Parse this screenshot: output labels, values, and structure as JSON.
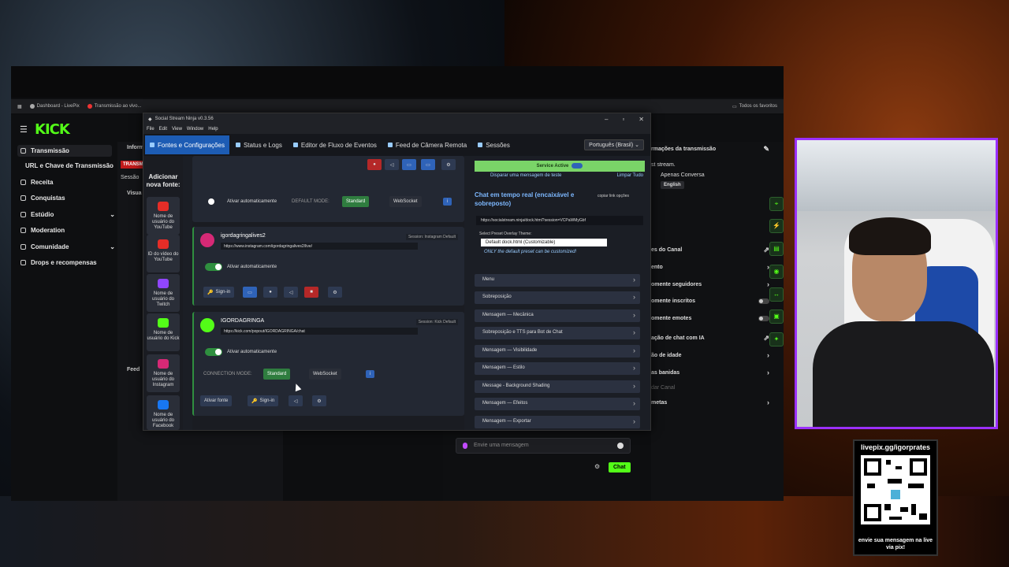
{
  "bookmarks": [
    {
      "label": "Dashboard - LivePix"
    },
    {
      "label": "Transmissão ao vivo..."
    }
  ],
  "bookmarks_right": "Todos os favoritos",
  "kick": {
    "logo": "KICK",
    "sidebar": [
      {
        "label": "Transmissão",
        "icon": "broadcast-icon",
        "active": true
      },
      {
        "label": "URL e Chave de Transmissão",
        "icon": ""
      },
      {
        "label": "Receita",
        "icon": "dollar-icon"
      },
      {
        "label": "Conquistas",
        "icon": "trophy-icon"
      },
      {
        "label": "Estúdio",
        "icon": "studio-icon",
        "chevron": true
      },
      {
        "label": "Moderation",
        "icon": "shield-icon"
      },
      {
        "label": "Comunidade",
        "icon": "community-icon",
        "chevron": true
      },
      {
        "label": "Drops e recompensas",
        "icon": "gift-icon"
      }
    ],
    "center_tabs": {
      "info": "Inform",
      "trans": "TRANSM",
      "sessao": "Sessão",
      "visual": "Visua",
      "feed": "Feed"
    },
    "right_panel": {
      "title": "rmações da transmissão",
      "line1": "st stream.",
      "line2": "Apenas Conversa",
      "tag": "English",
      "section": "es do Canal",
      "rows": [
        {
          "label": "ento",
          "control": "chevron"
        },
        {
          "label": "omente seguidores",
          "control": "chevron"
        },
        {
          "label": "omente inscritos",
          "control": "toggle"
        },
        {
          "label": "omente emotes",
          "control": "toggle"
        },
        {
          "label": "ação de chat com IA",
          "control": "external"
        },
        {
          "label": "ão de idade",
          "control": "chevron"
        },
        {
          "label": "as banidas",
          "control": "chevron"
        },
        {
          "label": "dar Canal",
          "control": "none"
        },
        {
          "label": "metas",
          "control": "chevron"
        }
      ]
    },
    "chat": {
      "placeholder": "Envie uma mensagem",
      "button": "Chat"
    }
  },
  "ssn": {
    "title": "Social Stream Ninja v0.3.56",
    "menu": [
      "File",
      "Edit",
      "View",
      "Window",
      "Help"
    ],
    "tabs": [
      {
        "label": "Fontes e Configurações",
        "active": true
      },
      {
        "label": "Status e Logs"
      },
      {
        "label": "Editor de Fluxo de Eventos"
      },
      {
        "label": "Feed de Câmera Remota"
      },
      {
        "label": "Sessões"
      }
    ],
    "language": "Português (Brasil)",
    "add_source": "Adicionar nova fonte:",
    "sources": [
      {
        "label": "Nome de usuário do YouTube",
        "color": "#e52d27"
      },
      {
        "label": "ID do vídeo do YouTube",
        "color": "#e52d27"
      },
      {
        "label": "Nome de usuário do Twitch",
        "color": "#9146ff"
      },
      {
        "label": "Nome de usuário do Kick",
        "color": "#53fc18"
      },
      {
        "label": "Nome de usuário do Instagram",
        "color": "#d62976"
      },
      {
        "label": "Nome de usuário do Facebook",
        "color": "#1877f2"
      }
    ],
    "card_top": {
      "auto_label": "Ativar automaticamente",
      "mode_label": "DEFAULT MODE:",
      "standard": "Standard",
      "websocket": "WebSocket"
    },
    "card_instagram": {
      "name": "igordagringalives2",
      "session": "Session: Instagram Default",
      "url": "https://www.instagram.com/igordagringalives2/live/",
      "auto_label": "Ativar automaticamente",
      "signin": "Sign-in"
    },
    "card_kick": {
      "name": "IGORDAGRINGA",
      "session": "Session: Kick Default",
      "url": "https://kick.com/popout/IGORDAGRINGA/chat",
      "auto_label": "Ativar automaticamente",
      "mode_label": "CONNECTION MODE:",
      "standard": "Standard",
      "websocket": "WebSocket",
      "activate": "Ativar fonte",
      "signin": "Sign-in"
    },
    "overlay": {
      "service": "Service Active",
      "send_test": "Disparar uma mensagem de teste",
      "clear_all": "Limpar Tudo",
      "chat_title": "Chat em tempo real (encaixável e sobreposto)",
      "copy_link": "copiar link",
      "options": "opções",
      "url": "https://socialstream.ninja/dock.html?session=VCPaWMyGbf",
      "preset_label": "Select Preset Overlay Theme:",
      "preset_value": "Default dock.html (Customizable)",
      "note": "ONLY the default preset can be customized!",
      "accordions": [
        "Menu",
        "Sobreposição",
        "Mensagem — Mecânica",
        "Sobreposição e TTS para Bot de Chat",
        "Mensagem — Visibilidade",
        "Mensagem — Estilo",
        "Message - Background Shading",
        "Mensagem — Efeitos",
        "Mensagem — Exportar"
      ]
    }
  },
  "qr": {
    "top": "livepix.gg/igorprates",
    "bottom": "envie sua mensagem na live via pix!"
  },
  "colors": {
    "kick_green": "#53fc18",
    "ssn_blue": "#1d5cb4",
    "cam_border": "#9b30ff"
  }
}
